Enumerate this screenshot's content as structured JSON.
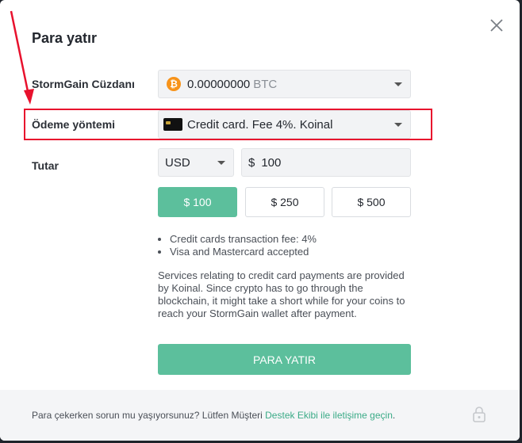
{
  "modal": {
    "title": "Para yatır"
  },
  "wallet": {
    "label": "StormGain Cüzdanı",
    "amount": "0.00000000",
    "currency": "BTC",
    "icon": "bitcoin-icon"
  },
  "payment": {
    "label": "Ödeme yöntemi",
    "selected": "Credit card. Fee 4%. Koinal",
    "icon": "credit-card-icon"
  },
  "amount": {
    "label": "Tutar",
    "currency_selected": "USD",
    "currency_symbol": "$",
    "value": "100",
    "presets": [
      "$ 100",
      "$ 250",
      "$ 500"
    ],
    "active_preset_index": 0
  },
  "notes": [
    "Credit cards transaction fee: 4%",
    "Visa and Mastercard accepted"
  ],
  "description": "Services relating to credit card payments are provided by Koinal. Since crypto has to go through the blockchain, it might take a short while for your coins to reach your StormGain wallet after payment.",
  "submit_label": "PARA YATIR",
  "footer": {
    "text": "Para çekerken sorun mu yaşıyorsunuz? Lütfen Müşteri ",
    "link": "Destek Ekibi ile iletişime geçin",
    "suffix": "."
  },
  "colors": {
    "accent": "#5cbf9c",
    "highlight": "#e8112d",
    "btc": "#f7931a"
  }
}
